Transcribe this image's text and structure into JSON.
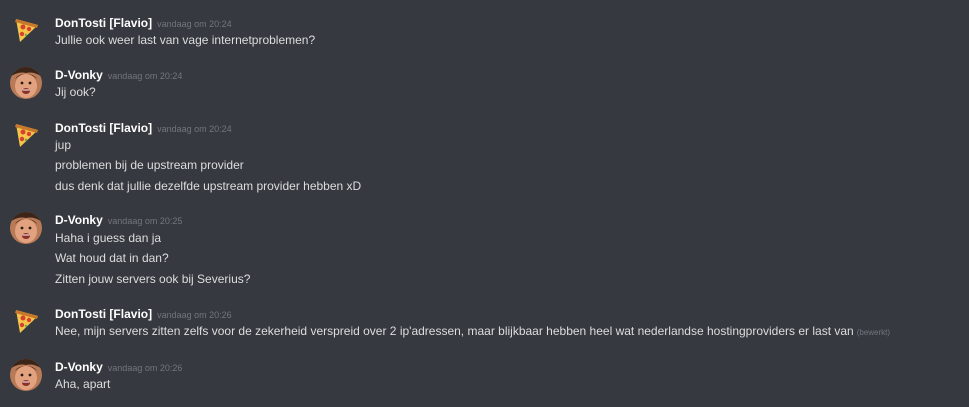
{
  "messages": [
    {
      "author": "DonTosti [Flavio]",
      "avatar": "pizza-icon",
      "timestamp": "vandaag om 20:24",
      "lines": [
        "Jullie ook weer last van vage internetproblemen?"
      ]
    },
    {
      "author": "D-Vonky",
      "avatar": "face-avatar",
      "timestamp": "vandaag om 20:24",
      "lines": [
        "Jij ook?"
      ]
    },
    {
      "author": "DonTosti [Flavio]",
      "avatar": "pizza-icon",
      "timestamp": "vandaag om 20:24",
      "lines": [
        "jup",
        "problemen bij de upstream provider",
        "dus denk dat jullie dezelfde upstream provider hebben xD"
      ]
    },
    {
      "author": "D-Vonky",
      "avatar": "face-avatar",
      "timestamp": "vandaag om 20:25",
      "lines": [
        "Haha i guess dan ja",
        "Wat houd dat in dan?",
        "Zitten jouw servers ook bij Severius?"
      ]
    },
    {
      "author": "DonTosti [Flavio]",
      "avatar": "pizza-icon",
      "timestamp": "vandaag om 20:26",
      "lines": [
        "Nee, mijn servers zitten zelfs voor de zekerheid verspreid over 2 ip'adressen, maar blijkbaar hebben heel wat nederlandse hostingproviders er last van"
      ],
      "edited_label": "(bewerkt)"
    },
    {
      "author": "D-Vonky",
      "avatar": "face-avatar",
      "timestamp": "vandaag om 20:26",
      "lines": [
        "Aha, apart"
      ]
    }
  ],
  "colors": {
    "background": "#36393f",
    "username": "#ffffff",
    "text": "#dcddde",
    "muted": "#72767d"
  }
}
